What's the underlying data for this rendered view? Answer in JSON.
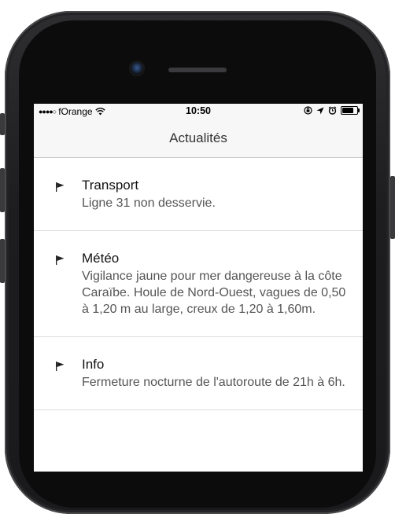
{
  "status_bar": {
    "signal_dots": "●●●●○",
    "carrier": "fOrange",
    "time": "10:50",
    "battery_percent": 80
  },
  "nav": {
    "title": "Actualités"
  },
  "news": [
    {
      "title": "Transport",
      "text": "Ligne 31 non desservie.",
      "icon": "flag-icon"
    },
    {
      "title": "Météo",
      "text": "Vigilance jaune pour mer dangereuse à la côte Caraïbe. Houle de Nord-Ouest, vagues de 0,50 à 1,20 m au large, creux de 1,20 à 1,60m.",
      "icon": "flag-icon"
    },
    {
      "title": "Info",
      "text": "Fermeture nocturne de l'autoroute de 21h à 6h.",
      "icon": "flag-icon"
    }
  ]
}
